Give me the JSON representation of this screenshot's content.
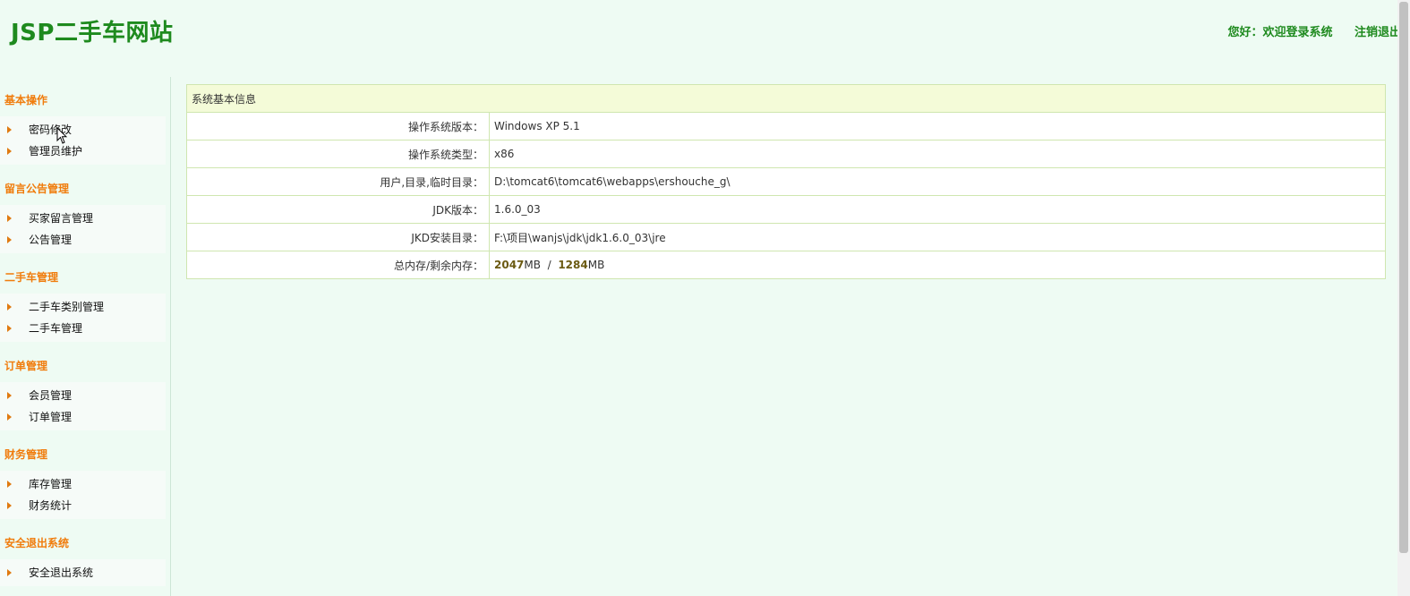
{
  "header": {
    "title": "JSP二手车网站",
    "greeting": "您好：欢迎登录系统",
    "logout": "注销退出"
  },
  "sidebar": {
    "sections": [
      {
        "title": "基本操作",
        "items": [
          "密码修改",
          "管理员维护"
        ]
      },
      {
        "title": "留言公告管理",
        "items": [
          "买家留言管理",
          "公告管理"
        ]
      },
      {
        "title": "二手车管理",
        "items": [
          "二手车类别管理",
          "二手车管理"
        ]
      },
      {
        "title": "订单管理",
        "items": [
          "会员管理",
          "订单管理"
        ]
      },
      {
        "title": "财务管理",
        "items": [
          "库存管理",
          "财务统计"
        ]
      },
      {
        "title": "安全退出系统",
        "items": [
          "安全退出系统"
        ]
      }
    ]
  },
  "info": {
    "caption": "系统基本信息",
    "rows": [
      {
        "key": "操作系统版本：",
        "value": "Windows XP  5.1"
      },
      {
        "key": "操作系统类型：",
        "value": "x86"
      },
      {
        "key": "用户,目录,临时目录：",
        "value": "D:\\tomcat6\\tomcat6\\webapps\\ershouche_g\\"
      },
      {
        "key": "JDK版本：",
        "value": "1.6.0_03"
      },
      {
        "key": "JKD安装目录：",
        "value": "F:\\项目\\wanjs\\jdk\\jdk1.6.0_03\\jre"
      }
    ],
    "memory": {
      "key": "总内存/剩余内存：",
      "total": "2047",
      "total_unit": "MB",
      "separator": "  /  ",
      "free": "1284",
      "free_unit": "MB"
    }
  },
  "colors": {
    "accent": "#1e8a1e",
    "section": "#f07c0c"
  }
}
